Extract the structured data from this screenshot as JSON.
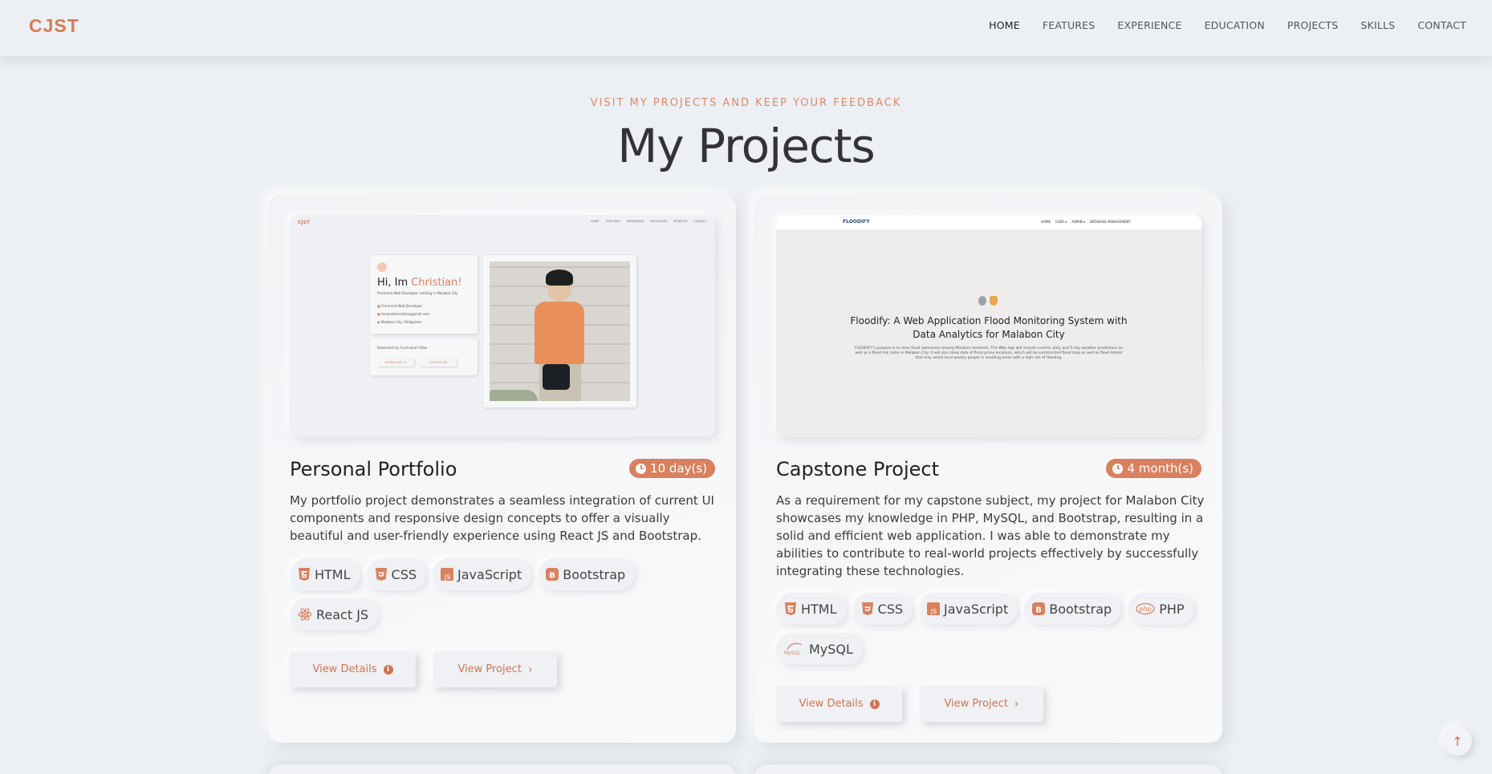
{
  "header": {
    "logo": "CJST",
    "nav": [
      "HOME",
      "FEATURES",
      "EXPERIENCE",
      "EDUCATION",
      "PROJECTS",
      "SKILLS",
      "CONTACT"
    ]
  },
  "section": {
    "subheading": "VISIT MY PROJECTS AND KEEP YOUR FEEDBACK",
    "heading": "My Projects"
  },
  "projects": [
    {
      "title": "Personal Portfolio",
      "duration": "10 day(s)",
      "description": "My portfolio project demonstrates a seamless integration of current UI components and responsive design concepts to offer a visually beautiful and user-friendly experience using React JS and Bootstrap.",
      "tags": [
        "HTML",
        "CSS",
        "JavaScript",
        "Bootstrap",
        "React JS"
      ],
      "details_label": "View Details",
      "project_label": "View Project",
      "preview": {
        "logo": "CJST",
        "nav": [
          "HOME",
          "FEATURES",
          "EXPERIENCE",
          "EDUCATION",
          "PROJECTS",
          "CONTACT"
        ],
        "greeting": "Hi, Im ",
        "name": "Christian!",
        "tagline": "Front-end Web Developer residing in Malabon City",
        "items": [
          "Front-end Web Developer",
          "fernandochristian@gmail.com",
          "Malabon City, Philippines"
        ],
        "cv_text": "Download my Curriculum Vitae",
        "cv_buttons": [
          "DOWNLOAD CV",
          "CONTACT ME"
        ]
      }
    },
    {
      "title": "Capstone Project",
      "duration": "4 month(s)",
      "description": "As a requirement for my capstone subject, my project for Malabon City showcases my knowledge in PHP, MySQL, and Bootstrap, resulting in a solid and efficient web application. I was able to demonstrate my abilities to contribute to real-world projects effectively by successfully integrating these technologies.",
      "tags": [
        "HTML",
        "CSS",
        "JavaScript",
        "Bootstrap",
        "PHP",
        "MySQL"
      ],
      "details_label": "View Details",
      "project_label": "View Project",
      "preview": {
        "logo": "FLOODIFY",
        "nav": [
          "HOME",
          "USER ▾",
          "ADMIN ▾",
          "DATABASE MANAGEMENT"
        ],
        "title": "Floodify: A Web Application Flood Monitoring System with Data Analytics for Malabon City",
        "text": "FLOODIFY's purpose is to raise flood awareness among Malabon residents. The Web App will include current, daily and 5-day weather predictions as well as a flood risk radar in Malabon City. It will also show data of flood prone locations, which will be summarized flood map as well as flood details that may assist local weekly people in avoiding areas with a high risk of flooding."
      }
    }
  ],
  "colors": {
    "accent": "#d9805f",
    "background": "#eceff3",
    "text": "#333333"
  },
  "icons": {
    "scroll_top": "arrow-up-icon",
    "duration": "clock-icon",
    "details": "info-icon",
    "project": "chevron-right-icon"
  }
}
